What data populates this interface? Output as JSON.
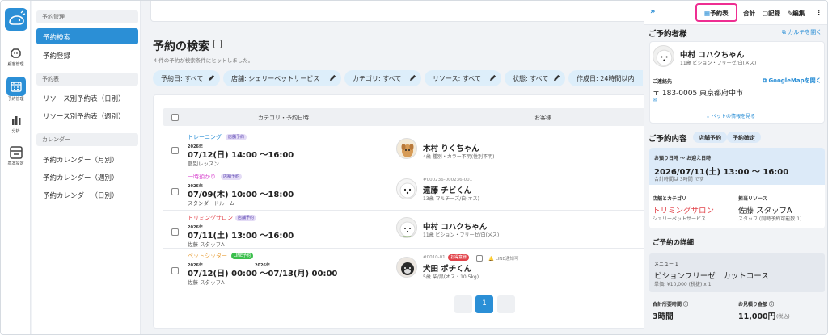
{
  "rail": [
    {
      "label": "顧客管理",
      "icon": "dog-icon"
    },
    {
      "label": "予約管理",
      "icon": "calendar-icon"
    },
    {
      "label": "分析",
      "icon": "bar-chart-icon"
    },
    {
      "label": "基本設定",
      "icon": "store-icon"
    }
  ],
  "subnav": {
    "sections": [
      "予約管理",
      "予約表",
      "カレンダー"
    ],
    "items": [
      "予約検索",
      "予約登録",
      "リソース別予約表（日別）",
      "リソース別予約表（週別）",
      "予約カレンダー（月別）",
      "予約カレンダー（週別）",
      "予約カレンダー（日別）"
    ]
  },
  "page": {
    "title": "予約の検索",
    "subtitle": "4 件の予約が検索条件にヒットしました。"
  },
  "filters": [
    "予約日: すべて",
    "店舗: シェリーペットサービス",
    "カテゴリ: すべて",
    "リソース: すべて",
    "状態: すべて",
    "作成日: 24時間以内"
  ],
  "table": {
    "headers": {
      "category": "カテゴリ・予約日時",
      "customer": "お客様"
    },
    "rows": [
      {
        "category": "トレーニング",
        "category_color": "#2b8fd6",
        "tags": [
          "店舗予約"
        ],
        "year": "2026年",
        "datetime": "07/12(日) 14:00 〜16:00",
        "detail": "個別レッスン",
        "id": "",
        "name": "木村 りくちゃん",
        "info": "4歳 種別・カラー不明(性別不明)",
        "avatar": "tan-dog"
      },
      {
        "category": "一時預かり",
        "category_color": "#d94bd0",
        "tags": [
          "店舗予約"
        ],
        "year": "2026年",
        "datetime": "07/09(木) 10:00 〜18:00",
        "detail": "スタンダードルーム",
        "id": "#000236-000236-001",
        "name": "遠藤 チビくん",
        "info": "13歳 マルチーズ/白(オス)",
        "avatar": "white-dog"
      },
      {
        "category": "トリミングサロン",
        "category_color": "#e2434a",
        "tags": [
          "店舗予約"
        ],
        "year": "2026年",
        "datetime": "07/11(土) 13:00 〜16:00",
        "detail": "佐藤 スタッフA",
        "id": "",
        "name": "中村 コハクちゃん",
        "info": "11歳 ビション・フリーゼ/白(メス)",
        "avatar": "bichon"
      },
      {
        "category": "ペットシッター",
        "category_color": "#e8a03c",
        "tags": [
          "LINE予約"
        ],
        "year": "2026年",
        "year2": "2026年",
        "datetime": "07/12(日) 00:00 〜07/13(月) 00:00",
        "detail": "佐藤 スタッフA",
        "id": "#0010-01",
        "badge": "お得意様",
        "line_note": "LINE通知可",
        "name": "犬田 ポチくん",
        "info": "5歳 柴/黒(オス・10.5kg)",
        "avatar": "black-dog"
      }
    ]
  },
  "pagination": {
    "current": "1"
  },
  "panel": {
    "toolbar": {
      "reservation": "予約表",
      "total": "合計",
      "record": "記録",
      "edit": "編集"
    },
    "customer_heading": "ご予約者様",
    "karte_link": "カルテを開く",
    "customer_name": "中村 コハクちゃん",
    "customer_info": "11歳 ビション・フリーゼ/白(メス)",
    "contact_label": "ご連絡先",
    "map_link": "GoogleMapを開く",
    "address": "〒 183-0005 東京都府中市",
    "pet_info_link": "ペットの情報を見る",
    "content_heading": "ご予約内容",
    "pills": [
      "店舗予約",
      "予約確定"
    ],
    "time_label": "お預り日時 〜 お迎え日時",
    "time_value": "2026/07/11(土) 13:00 〜 16:00",
    "time_note": "合計時間は 3時間 です",
    "store_label": "店舗とカテゴリ",
    "store_category": "トリミングサロン",
    "store_name": "シェリーペットサービス",
    "resource_label": "担当リソース",
    "resource_name": "佐藤 スタッフA",
    "resource_note": "スタッフ (同時予約可能数:1)",
    "detail_heading": "ご予約の詳細",
    "menu_label": "メニュー 1",
    "menu_name": "ビションフリーゼ　カットコース",
    "menu_price": "単価: ¥10,000 (税抜) x 1",
    "duration_label": "合計所要時間",
    "duration_value": "3時間",
    "estimate_label": "お見積り金額",
    "estimate_value": "11,000円",
    "estimate_tax": "(税込)"
  },
  "colors": {
    "accent": "#2b8fd6",
    "highlight": "#ee2e92",
    "chip_bg": "#ddeefa"
  }
}
